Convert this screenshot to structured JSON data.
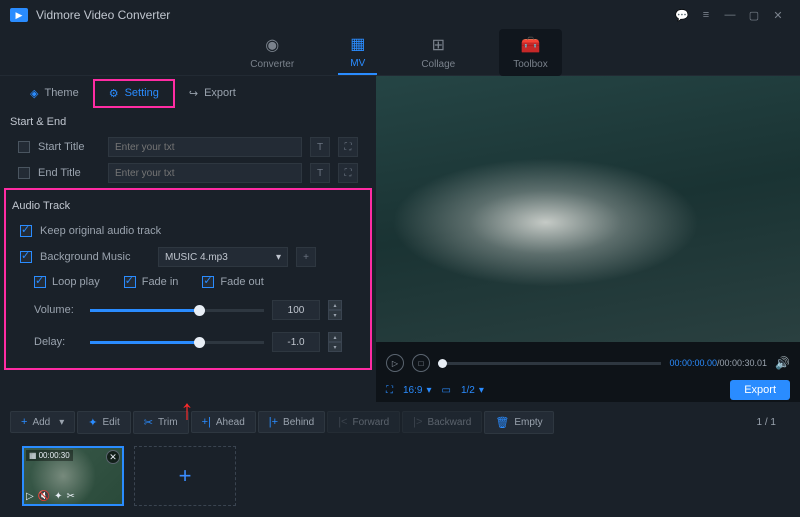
{
  "app": {
    "title": "Vidmore Video Converter"
  },
  "mainTabs": {
    "converter": "Converter",
    "mv": "MV",
    "collage": "Collage",
    "toolbox": "Toolbox"
  },
  "subTabs": {
    "theme": "Theme",
    "setting": "Setting",
    "export": "Export"
  },
  "startEnd": {
    "title": "Start & End",
    "startLabel": "Start Title",
    "endLabel": "End Title",
    "placeholder": "Enter your txt"
  },
  "audio": {
    "title": "Audio Track",
    "keepOriginal": "Keep original audio track",
    "bgMusic": "Background Music",
    "musicFile": "MUSIC 4.mp3",
    "loop": "Loop play",
    "fadeIn": "Fade in",
    "fadeOut": "Fade out",
    "volumeLabel": "Volume:",
    "volumeValue": "100",
    "delayLabel": "Delay:",
    "delayValue": "-1.0"
  },
  "preview": {
    "currentTime": "00:00:00.00",
    "totalTime": "00:00:30.01",
    "aspect": "16:9",
    "split": "1/2",
    "exportBtn": "Export"
  },
  "toolbar": {
    "add": "Add",
    "edit": "Edit",
    "trim": "Trim",
    "ahead": "Ahead",
    "behind": "Behind",
    "forward": "Forward",
    "backward": "Backward",
    "empty": "Empty",
    "page": "1 / 1"
  },
  "clip": {
    "duration": "00:00:30"
  }
}
